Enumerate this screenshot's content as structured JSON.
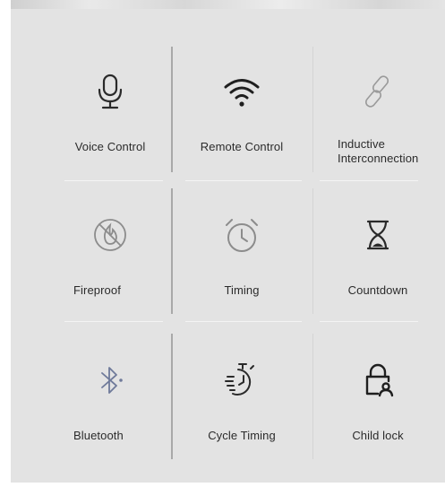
{
  "features": [
    {
      "id": "voice",
      "label": "Voice Control",
      "icon": "microphone-icon"
    },
    {
      "id": "remote",
      "label": "Remote Control",
      "icon": "wifi-icon"
    },
    {
      "id": "inductive",
      "label_line1": "Inductive",
      "label_line2": "Interconnection",
      "icon": "link-icon"
    },
    {
      "id": "fireproof",
      "label": "Fireproof",
      "icon": "fireproof-icon"
    },
    {
      "id": "timing",
      "label": "Timing",
      "icon": "alarm-clock-icon"
    },
    {
      "id": "countdown",
      "label": "Countdown",
      "icon": "hourglass-icon"
    },
    {
      "id": "bluetooth",
      "label": "Bluetooth",
      "icon": "bluetooth-icon"
    },
    {
      "id": "cycle",
      "label": "Cycle Timing",
      "icon": "stopwatch-icon"
    },
    {
      "id": "childlock",
      "label": "Child lock",
      "icon": "child-lock-icon"
    }
  ],
  "colors": {
    "panel_bg": "#e3e3e3",
    "icon_dark": "#2a2a2a",
    "icon_light": "#9a9a9a",
    "bluetooth_icon": "#6f7a9a",
    "text": "#2b2b2b",
    "divider": "#a9a9a9"
  }
}
